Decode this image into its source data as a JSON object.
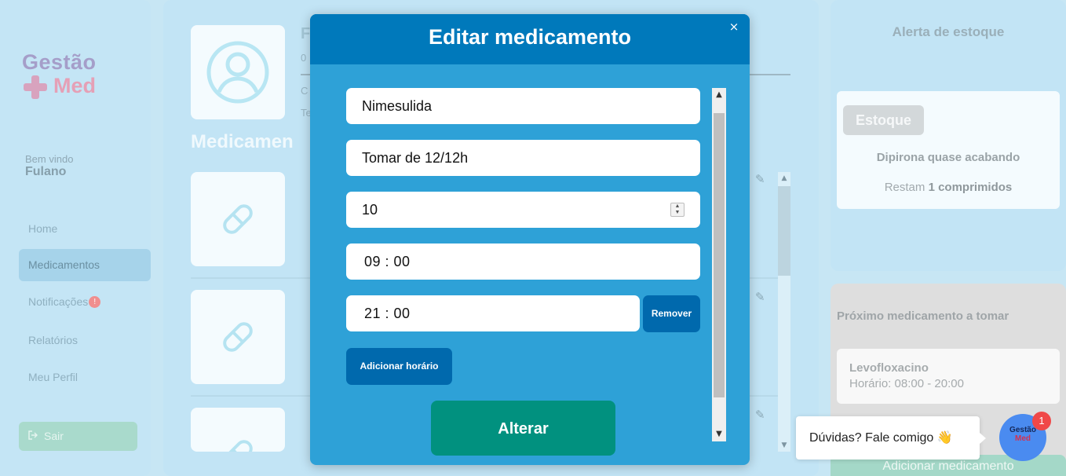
{
  "sidebar": {
    "logo_top": "Gestão",
    "logo_bottom": "Med",
    "welcome": "Bem vindo",
    "username": "Fulano",
    "items": [
      {
        "label": "Home"
      },
      {
        "label": "Medicamentos"
      },
      {
        "label": "Notificações"
      },
      {
        "label": "Relatórios"
      },
      {
        "label": "Meu Perfil"
      }
    ],
    "notification_badge": "!",
    "logout": "Sair"
  },
  "main": {
    "profile_name": "F",
    "profile_line1": "0",
    "profile_line2": "C",
    "profile_line3": "Te",
    "section_title": "Medicamen"
  },
  "stock_alert": {
    "title": "Alerta de estoque",
    "badge": "Estoque",
    "message": "Dipirona quase acabando",
    "remain_prefix": "Restam",
    "remain_value": "1 comprimidos"
  },
  "next_med": {
    "title": "Próximo medicamento a tomar",
    "name": "Levofloxacino",
    "time": "Horário: 08:00 - 20:00",
    "add_button": "Adicionar medicamento"
  },
  "modal": {
    "title": "Editar medicamento",
    "close": "×",
    "name_value": "Nimesulida",
    "instructions_value": "Tomar de 12/12h",
    "quantity_value": "10",
    "time1_value": "09 : 00",
    "time2_value": "21 : 00",
    "remove_label": "Remover",
    "add_time_label": "Adicionar horário",
    "submit_label": "Alterar"
  },
  "chat": {
    "tooltip": "Dúvidas? Fale comigo 👋",
    "avatar_top": "Gestão",
    "avatar_bottom": "Med",
    "badge_count": "1"
  },
  "colors": {
    "modal_bg": "#2ea1d7",
    "modal_header": "#0079bb",
    "button_blue": "#0069ad",
    "submit_green": "#01917f"
  }
}
